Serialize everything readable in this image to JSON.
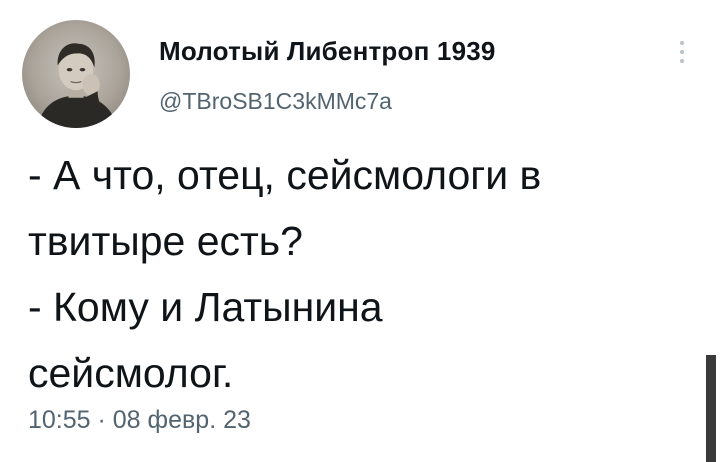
{
  "tweet": {
    "author_name": "Молотый Либентроп 1939",
    "author_handle": "@TBroSB1C3kMMc7a",
    "text_lines": [
      "- А что, отец, сейсмологи в",
      "твитыре есть?",
      "- Кому и Латынина",
      "сейсмолог."
    ],
    "timestamp": "10:55 · 08 февр. 23",
    "avatar_icon": "user-avatar-photo",
    "more_icon": "more-vertical-icon"
  },
  "colors": {
    "text": "#0f1419",
    "secondary_text": "#536471",
    "background": "#ffffff"
  }
}
